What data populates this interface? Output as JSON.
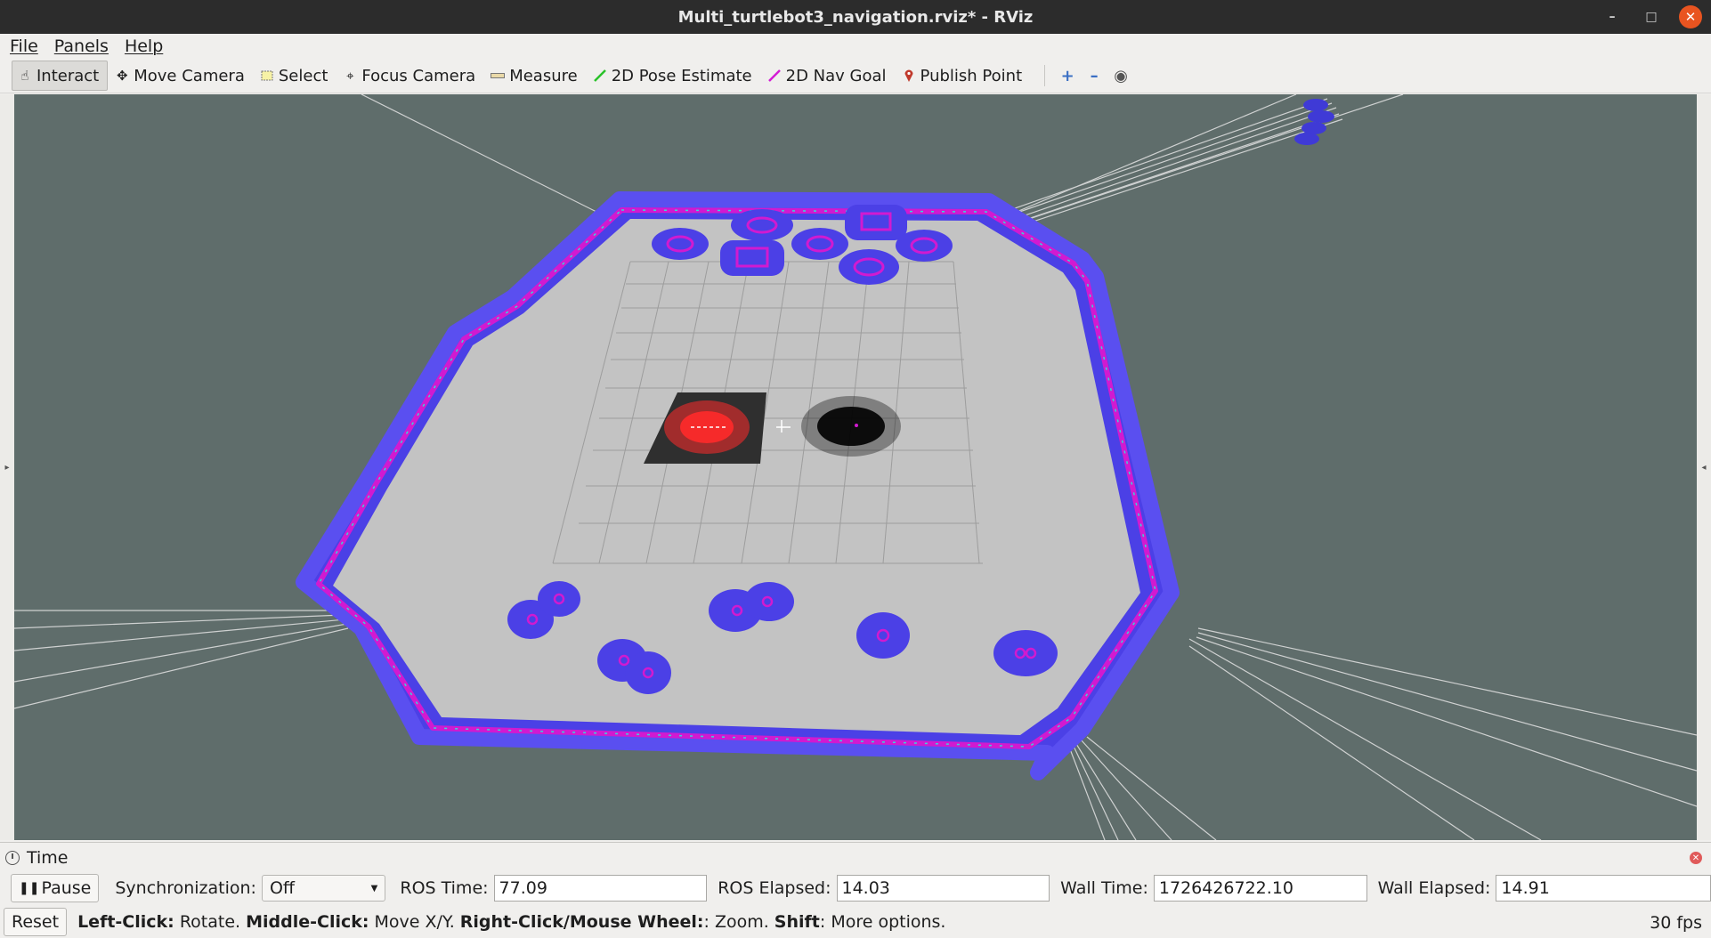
{
  "window": {
    "title": "Multi_turtlebot3_navigation.rviz* - RViz",
    "controls": [
      "minimize-icon",
      "restore-icon",
      "close-icon"
    ]
  },
  "menu": [
    "File",
    "Panels",
    "Help"
  ],
  "toolbar": {
    "tools": [
      {
        "label": "Interact",
        "icon": "hand-icon",
        "active": true
      },
      {
        "label": "Move Camera",
        "icon": "move-camera-icon"
      },
      {
        "label": "Select",
        "icon": "select-box-icon"
      },
      {
        "label": "Focus Camera",
        "icon": "focus-icon"
      },
      {
        "label": "Measure",
        "icon": "ruler-icon"
      },
      {
        "label": "2D Pose Estimate",
        "icon": "green-arrow-icon"
      },
      {
        "label": "2D Nav Goal",
        "icon": "magenta-arrow-icon"
      },
      {
        "label": "Publish Point",
        "icon": "map-pin-icon"
      }
    ],
    "extra": [
      "plus-icon",
      "minus-icon",
      "eye-icon"
    ]
  },
  "time_panel": {
    "title": "Time",
    "pause_label": "Pause",
    "sync_label": "Synchronization:",
    "sync_value": "Off",
    "ros_time_label": "ROS Time:",
    "ros_time": "77.09",
    "ros_elapsed_label": "ROS Elapsed:",
    "ros_elapsed": "14.03",
    "wall_time_label": "Wall Time:",
    "wall_time": "1726426722.10",
    "wall_elapsed_label": "Wall Elapsed:",
    "wall_elapsed": "14.91"
  },
  "status": {
    "reset_label": "Reset",
    "hint_left_key": "Left-Click:",
    "hint_left": " Rotate. ",
    "hint_mid_key": "Middle-Click:",
    "hint_mid": " Move X/Y. ",
    "hint_right_key": "Right-Click/Mouse Wheel:",
    "hint_right": ": Zoom. ",
    "hint_shift_key": "Shift",
    "hint_shift": ": More options.",
    "fps": "30 fps"
  },
  "colors": {
    "viewport_bg": "#5f6d6b",
    "map_floor": "#c3c3c3",
    "costmap_blue": "#4a3fe0",
    "costmap_magenta": "#d11ad0",
    "costmap_cyan": "#32d6d6",
    "particles_red": "#ff2a2a",
    "particles_black": "#000000"
  }
}
